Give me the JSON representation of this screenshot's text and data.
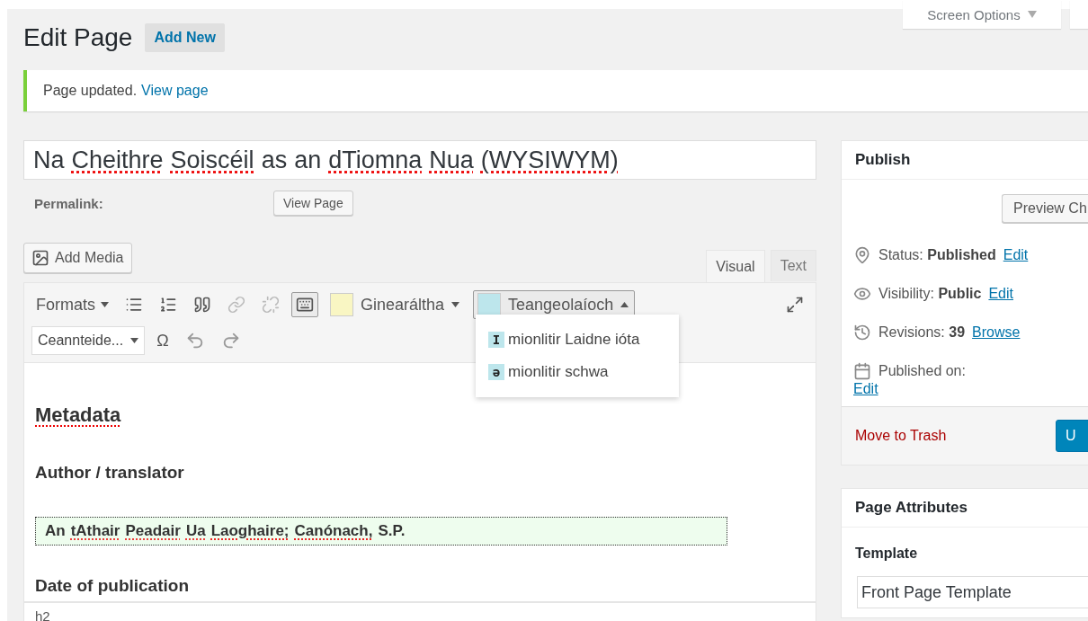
{
  "header": {
    "title": "Edit Page",
    "add_new": "Add New",
    "screen_options": "Screen Options"
  },
  "notice": {
    "message": "Page updated.",
    "link": "View page"
  },
  "post_title": {
    "words": [
      {
        "text": "Na",
        "misspelled": false
      },
      {
        "text": "Cheithre",
        "misspelled": true
      },
      {
        "text": "Soiscéil",
        "misspelled": true
      },
      {
        "text": "as",
        "misspelled": false
      },
      {
        "text": "an",
        "misspelled": false
      },
      {
        "text": "dTiomna",
        "misspelled": true
      },
      {
        "text": "Nua",
        "misspelled": true
      },
      {
        "text": "(WYSIWYM)",
        "misspelled": true
      }
    ]
  },
  "permalink": {
    "label": "Permalink:",
    "button": "View Page"
  },
  "add_media": "Add Media",
  "editor_tabs": [
    {
      "label": "Visual",
      "selected": true
    },
    {
      "label": "Text",
      "selected": false
    }
  ],
  "toolbar": {
    "formats": "Formats",
    "row1": [
      {
        "kind": "bullet-list",
        "disabled": false,
        "pressed": false
      },
      {
        "kind": "numbered-list",
        "disabled": false,
        "pressed": false
      },
      {
        "kind": "quote",
        "disabled": false,
        "pressed": false
      },
      {
        "kind": "link",
        "disabled": true,
        "pressed": false
      },
      {
        "kind": "unlink",
        "disabled": true,
        "pressed": false
      },
      {
        "kind": "toolbar-toggle",
        "disabled": false,
        "pressed": true
      }
    ],
    "styles": [
      {
        "label": "Ginearáltha",
        "color": "#f9f6c3",
        "expanded": false
      },
      {
        "label": "Teangeolaíoch",
        "color": "#bde6ec",
        "expanded": true
      }
    ],
    "heading_select": "Ceannteide...",
    "special_char": "Ω",
    "row2": [
      {
        "kind": "undo",
        "disabled": false
      },
      {
        "kind": "redo",
        "disabled": false
      }
    ]
  },
  "style_menu": [
    {
      "glyph": "I",
      "label": "mionlitir Laidne ióta"
    },
    {
      "glyph": "ə",
      "label": "mionlitir schwa"
    }
  ],
  "content": [
    {
      "kind": "h2",
      "text": "Metadata",
      "misspelled": true
    },
    {
      "kind": "h3",
      "text": "Author / translator",
      "misspelled": false
    },
    {
      "kind": "boxed",
      "words": [
        {
          "text": "An",
          "misspelled": false
        },
        {
          "text": "tAthair",
          "misspelled": true
        },
        {
          "text": "Peadair",
          "misspelled": true
        },
        {
          "text": "Ua",
          "misspelled": true
        },
        {
          "text": "Laoghaire;",
          "misspelled": true
        },
        {
          "text": "Canónach,",
          "misspelled": true
        },
        {
          "text": "S.P.",
          "misspelled": false
        }
      ]
    },
    {
      "kind": "h3",
      "text": "Date of publication",
      "misspelled": false
    }
  ],
  "status_path": "h2",
  "publish": {
    "title": "Publish",
    "preview": "Preview Ch",
    "rows": [
      {
        "kind": "status",
        "label": "Status:",
        "value": "Published",
        "link": "Edit"
      },
      {
        "kind": "visibility",
        "label": "Visibility:",
        "value": "Public",
        "link": "Edit"
      },
      {
        "kind": "revisions",
        "label": "Revisions:",
        "value": "39",
        "link": "Browse"
      },
      {
        "kind": "published-on",
        "label": "Published on:",
        "link": "Edit"
      }
    ],
    "trash": "Move to Trash",
    "update": "U"
  },
  "page_attributes": {
    "title": "Page Attributes",
    "template_label": "Template",
    "template": "Front Page Template"
  }
}
